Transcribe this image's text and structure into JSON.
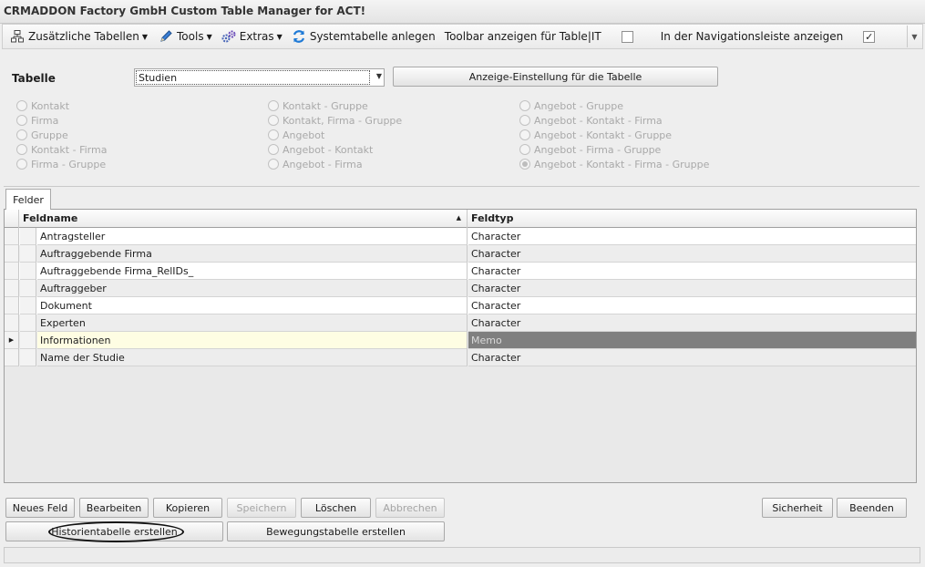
{
  "window": {
    "title": "CRMADDON Factory GmbH Custom Table Manager for ACT!"
  },
  "toolbar": {
    "items": [
      {
        "label": "Zusätzliche Tabellen",
        "icon": "table-tree-icon",
        "dropdown": true
      },
      {
        "label": "Tools",
        "icon": "pencil-icon",
        "dropdown": true
      },
      {
        "label": "Extras",
        "icon": "gears-icon",
        "dropdown": true
      },
      {
        "label": "Systemtabelle anlegen",
        "icon": "refresh-icon",
        "dropdown": false
      }
    ],
    "show_toolbar_label": "Toolbar anzeigen für Table|IT",
    "show_toolbar_checked": false,
    "show_toolbar_glyph": "",
    "nav_label": "In der Navigationsleiste anzeigen",
    "nav_checked": true,
    "nav_glyph": "✓"
  },
  "table_selector": {
    "label": "Tabelle",
    "value": "Studien",
    "display_settings_button": "Anzeige-Einstellung für die Tabelle"
  },
  "relations": {
    "col1": [
      "Kontakt",
      "Firma",
      "Gruppe",
      "Kontakt - Firma",
      "Firma - Gruppe"
    ],
    "col2": [
      "Kontakt - Gruppe",
      "Kontakt, Firma - Gruppe",
      "Angebot",
      "Angebot - Kontakt",
      "Angebot - Firma"
    ],
    "col3": [
      "Angebot - Gruppe",
      "Angebot - Kontakt - Firma",
      "Angebot - Kontakt - Gruppe",
      "Angebot - Firma - Gruppe",
      "Angebot - Kontakt - Firma - Gruppe"
    ],
    "selected": "Angebot - Kontakt - Firma - Gruppe"
  },
  "tabs": [
    {
      "label": "Felder"
    }
  ],
  "grid": {
    "columns": [
      "Feldname",
      "Feldtyp"
    ],
    "sort_glyph": "▲",
    "current_row_glyph": "▶",
    "rows": [
      {
        "name": "Antragsteller",
        "type": "Character"
      },
      {
        "name": "Auftraggebende Firma",
        "type": "Character"
      },
      {
        "name": "Auftraggebende Firma_RelIDs_",
        "type": "Character"
      },
      {
        "name": "Auftraggeber",
        "type": "Character"
      },
      {
        "name": "Dokument",
        "type": "Character"
      },
      {
        "name": "Experten",
        "type": "Character"
      },
      {
        "name": "Informationen",
        "type": "Memo"
      },
      {
        "name": "Name der Studie",
        "type": "Character"
      }
    ],
    "current_row": 6
  },
  "buttons": {
    "new_field": "Neues Feld",
    "edit": "Bearbeiten",
    "copy": "Kopieren",
    "save": "Speichern",
    "delete": "Löschen",
    "cancel": "Abbrechen",
    "backup": "Sicherheit",
    "exit": "Beenden",
    "history_table": "Historientabelle erstellen",
    "movement_table": "Bewegungstabelle erstellen"
  },
  "colors": {
    "current_row_bg": "#fefde3",
    "current_type_bg": "#7f7f7f",
    "current_type_fg": "#d9d9d9",
    "row_alt_bg": "#ededed",
    "disabled_text": "#a9a9a9"
  }
}
